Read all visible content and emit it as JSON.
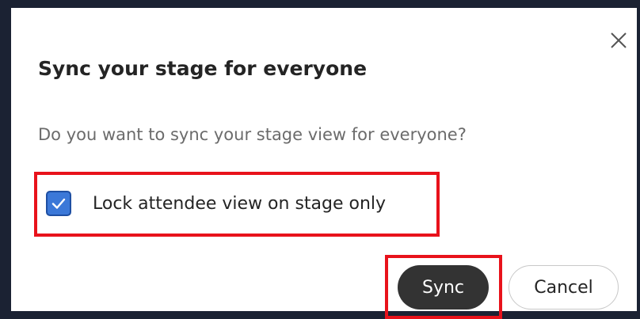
{
  "dialog": {
    "title": "Sync your stage for everyone",
    "description": "Do you want to sync your stage view for everyone?",
    "close_icon": "close-icon",
    "checkbox": {
      "label": "Lock attendee view on stage only",
      "checked": true,
      "color": "#3b78d8"
    },
    "buttons": {
      "sync_label": "Sync",
      "cancel_label": "Cancel"
    }
  },
  "colors": {
    "highlight": "#e8121b",
    "primary_button": "#333333",
    "backdrop": "#1b2233"
  }
}
